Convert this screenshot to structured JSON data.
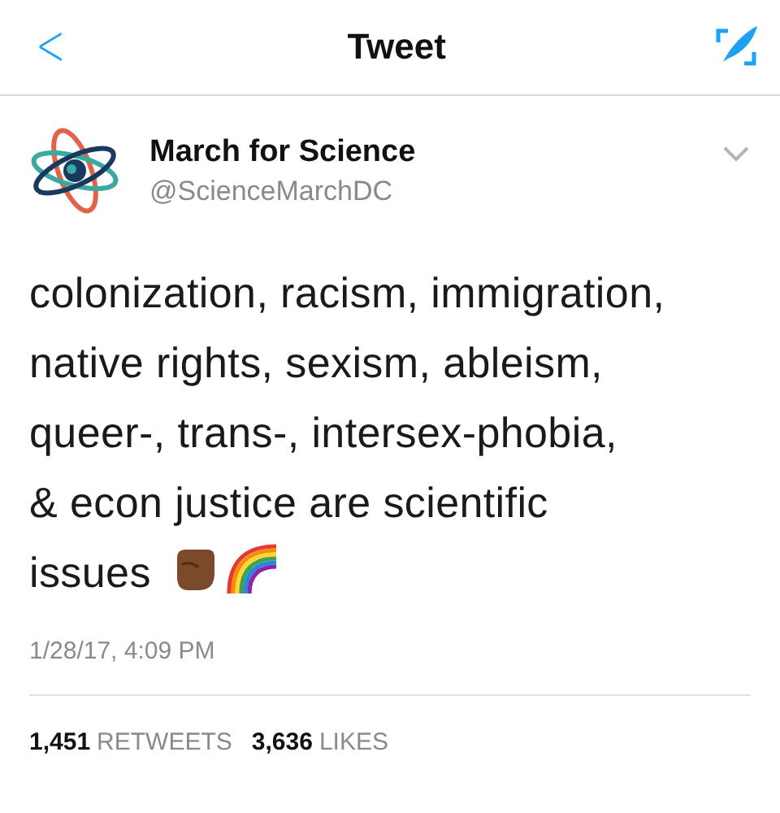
{
  "header": {
    "back": "<",
    "title": "Tweet"
  },
  "tweet": {
    "author": {
      "name": "March for Science",
      "handle": "@ScienceMarchDC"
    },
    "lines": [
      "colonization, racism, immigration,",
      "native rights, sexism, ableism,",
      "queer-, trans-, intersex-phobia,",
      "& econ justice are scientific",
      "issues"
    ],
    "timestamp": "1/28/17, 4:09 PM",
    "stats": [
      {
        "count": "1,451",
        "label": "RETWEETS"
      },
      {
        "count": "3,636",
        "label": "LIKES"
      }
    ]
  }
}
